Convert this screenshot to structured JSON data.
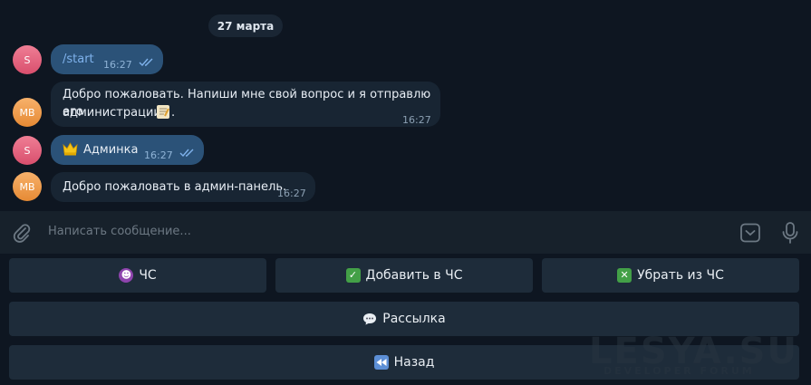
{
  "chat": {
    "date_label": "27 марта",
    "messages": [
      {
        "sender_initials": "S",
        "text": "/start",
        "time": "16:27",
        "outgoing": true
      },
      {
        "sender_initials": "MB",
        "text_line1": "Добро пожаловать. Напиши мне свой вопрос и я отправлю его",
        "text_line2": "администрации",
        "text_line2_tail": ".",
        "time": "16:27",
        "outgoing": false
      },
      {
        "sender_initials": "S",
        "text": "Админка",
        "time": "16:27",
        "outgoing": true
      },
      {
        "sender_initials": "MB",
        "text": "Добро пожаловать в админ-панель.",
        "time": "16:27",
        "outgoing": false
      }
    ]
  },
  "composer": {
    "placeholder": "Написать сообщение..."
  },
  "keyboard": {
    "rows": [
      [
        {
          "label": "ЧС",
          "icon": "devil-icon"
        },
        {
          "label": "Добавить в ЧС",
          "icon": "check-mark-icon"
        },
        {
          "label": "Убрать из ЧС",
          "icon": "cross-mark-icon"
        }
      ],
      [
        {
          "label": "Рассылка",
          "icon": "speech-bubble-icon"
        }
      ],
      [
        {
          "label": "Назад",
          "icon": "rewind-icon"
        }
      ]
    ]
  },
  "watermark": {
    "title": "LESYA.SU",
    "subtitle": "DEVELOPER FORUM"
  },
  "colors": {
    "background": "#0e1621",
    "outgoing_bubble": "#2b5278",
    "incoming_bubble": "#182533",
    "composer": "#17212b",
    "keyboard_button": "#1e2c3a",
    "check_green": "#4caf50"
  }
}
